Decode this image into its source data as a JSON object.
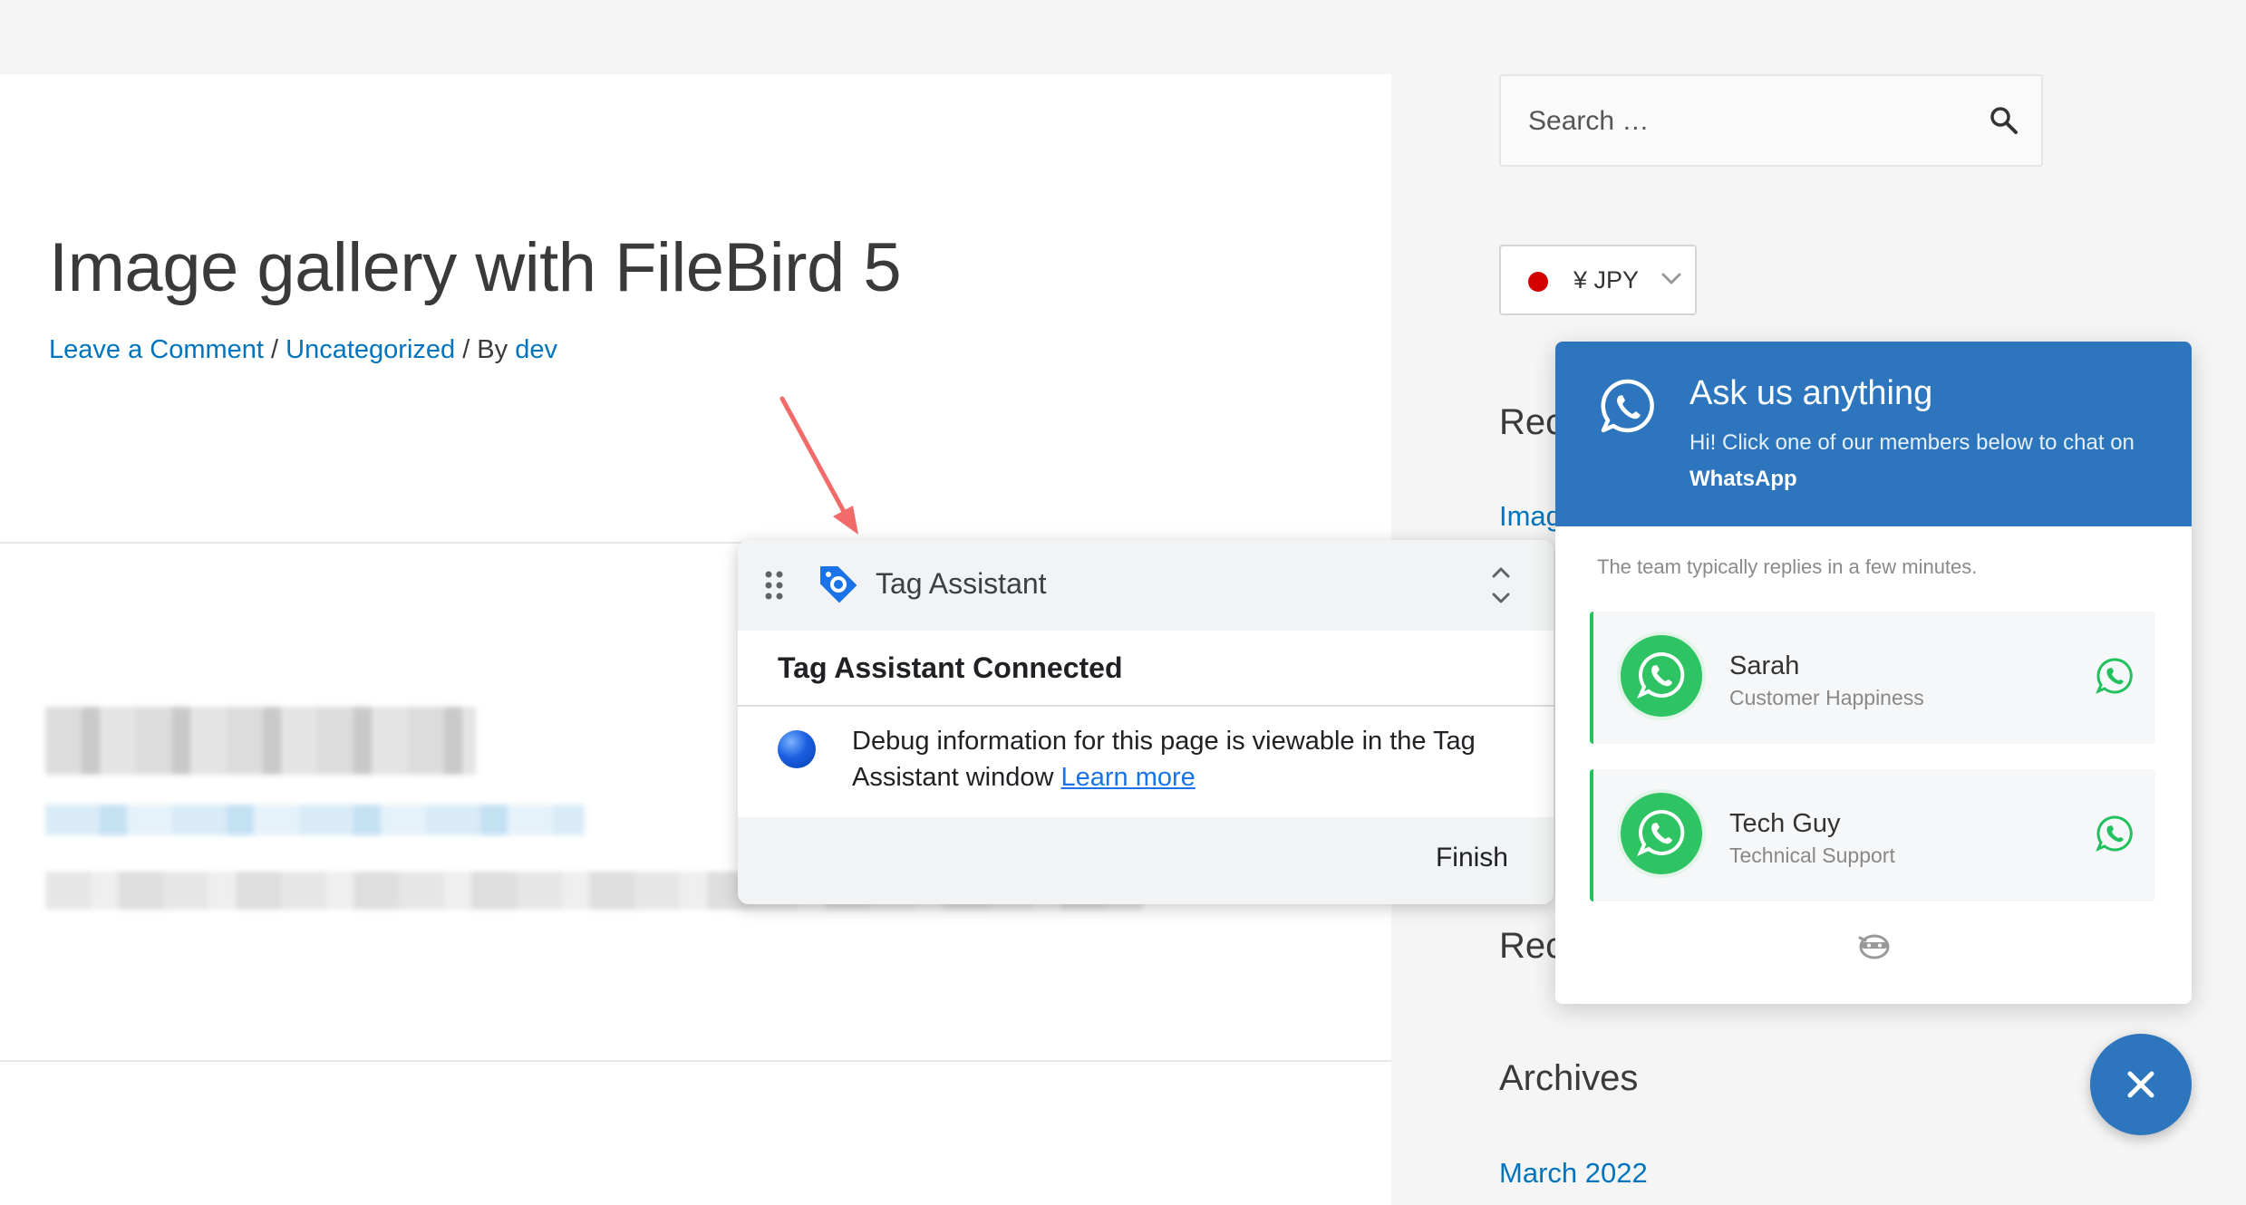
{
  "post": {
    "title": "Image gallery with FileBird 5",
    "meta_comment": "Leave a Comment",
    "meta_sep1": " / ",
    "meta_category": "Uncategorized",
    "meta_sep2": " / By ",
    "meta_author": "dev"
  },
  "tag_assistant": {
    "title": "Tag Assistant",
    "status": "Tag Assistant Connected",
    "message": "Debug information for this page is viewable in the Tag Assistant window",
    "learn_more": "Learn more",
    "finish": "Finish",
    "logo_color": "#1a73e8"
  },
  "sidebar": {
    "search_placeholder": "Search …",
    "currency_label": "¥ JPY",
    "currency_flag_color": "#d40000",
    "recent_posts_heading": "Rec",
    "recent_post_link": "Imag",
    "recent_comments_heading": "Rec",
    "archives_heading": "Archives",
    "archive_link": "March 2022"
  },
  "whatsapp": {
    "title": "Ask us anything",
    "subtitle_prefix": "Hi! Click one of our members below to chat on ",
    "subtitle_brand": "WhatsApp",
    "reply_note": "The team typically replies in a few minutes.",
    "members": [
      {
        "name": "Sarah",
        "role": "Customer Happiness"
      },
      {
        "name": "Tech Guy",
        "role": "Technical Support"
      }
    ],
    "brand_color": "#2d75bd",
    "whatsapp_green": "#22c15e"
  },
  "colors": {
    "link": "#0274be",
    "arrow": "#f26b6b"
  }
}
